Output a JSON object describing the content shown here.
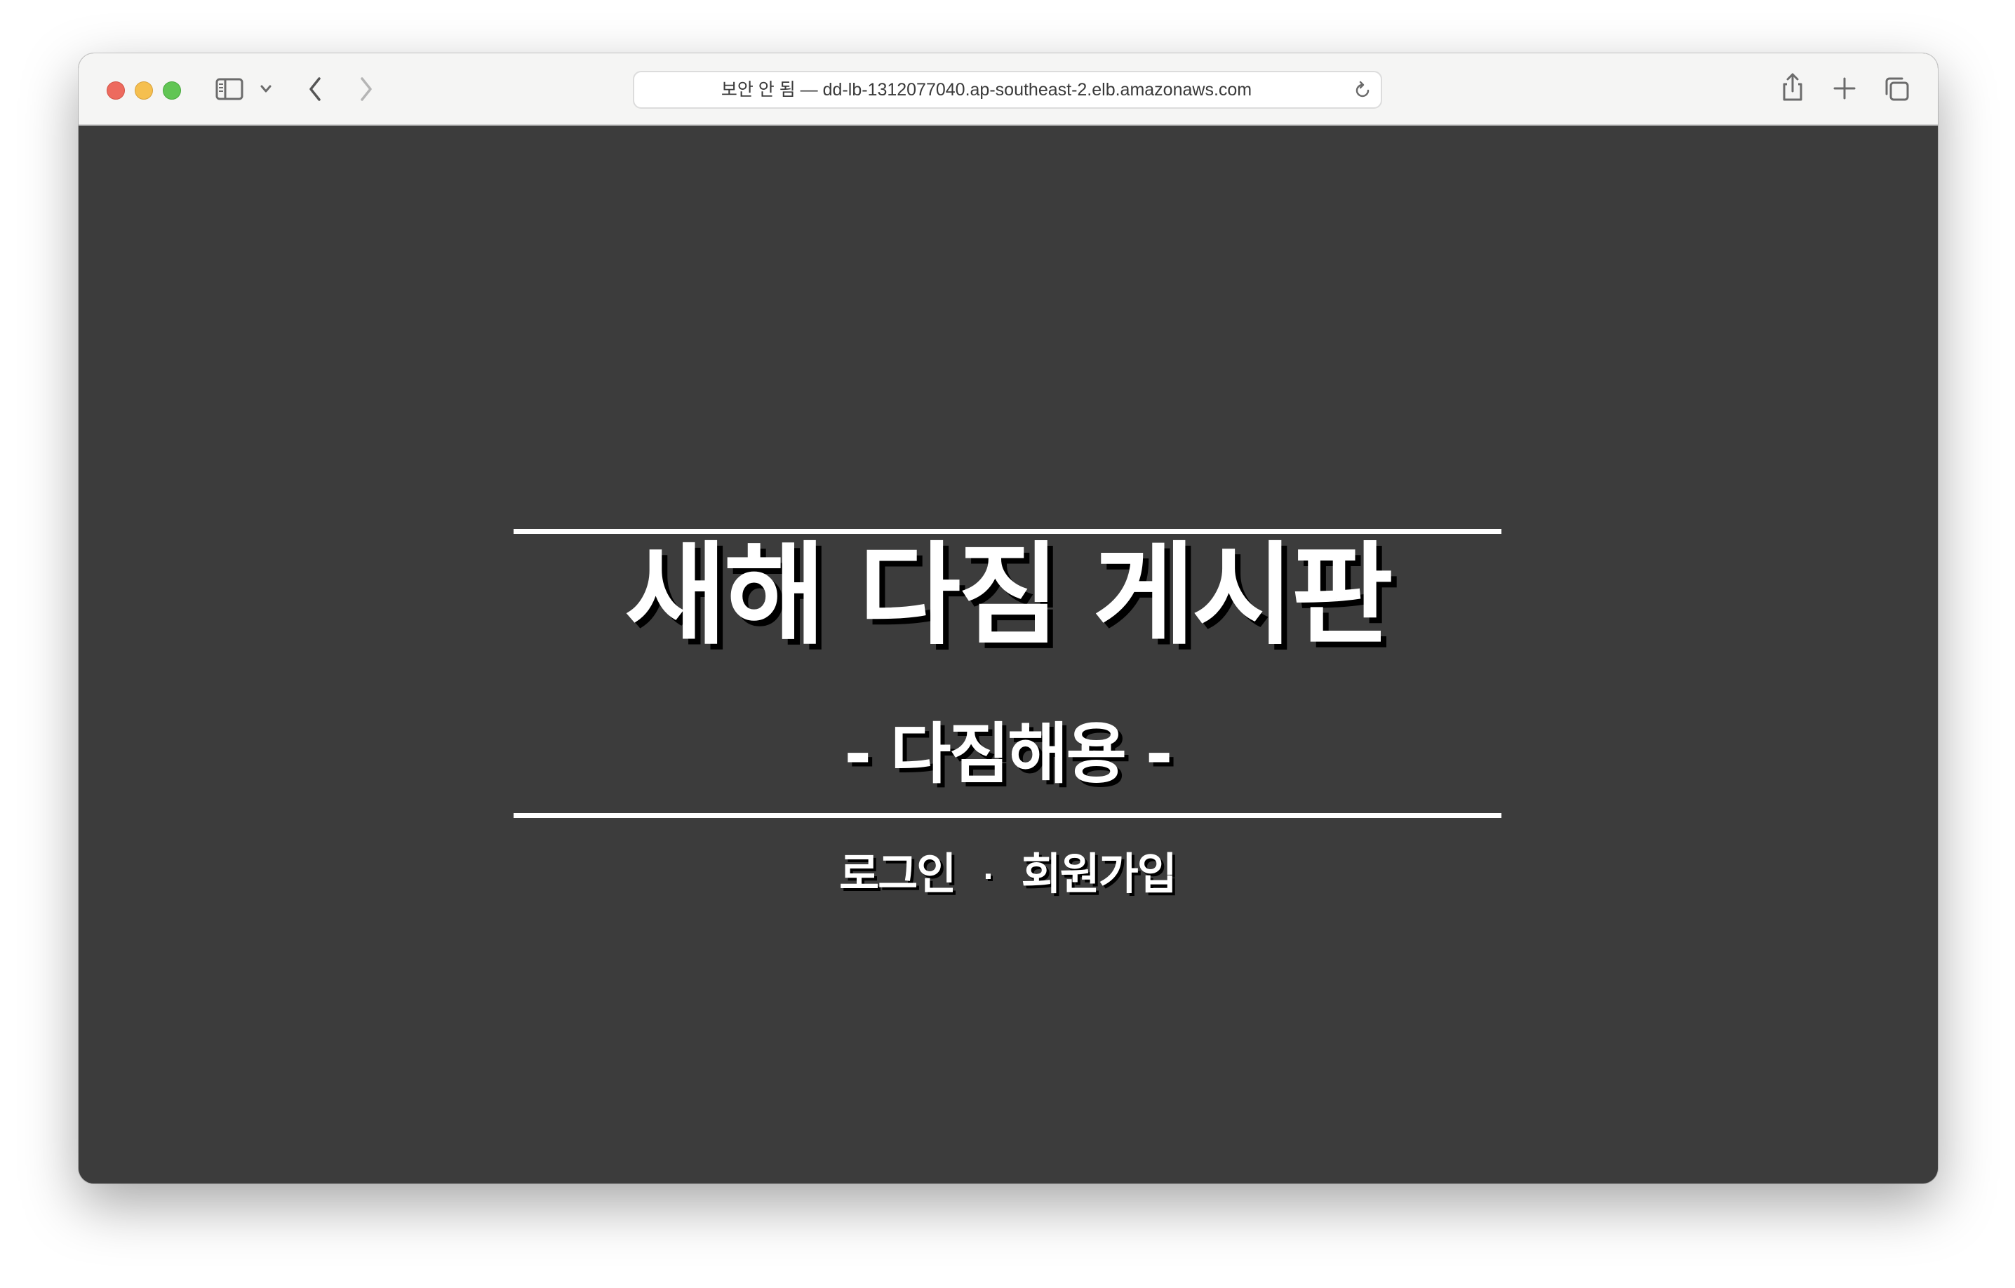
{
  "browser": {
    "address_text": "보안 안 됨 — dd-lb-1312077040.ap-southeast-2.elb.amazonaws.com",
    "icons": [
      "close-button",
      "minimize-button",
      "maximize-button",
      "sidebar-icon",
      "chevron-down-icon",
      "back-icon",
      "forward-icon",
      "reload-icon",
      "share-icon",
      "new-tab-icon",
      "tab-overview-icon"
    ]
  },
  "page": {
    "title": "새해 다짐 게시판",
    "subtitle": "- 다짐해용 -",
    "login_label": "로그인",
    "separator": "·",
    "signup_label": "회원가입",
    "background_color": "#3c3c3c",
    "text_color": "#ffffff"
  }
}
